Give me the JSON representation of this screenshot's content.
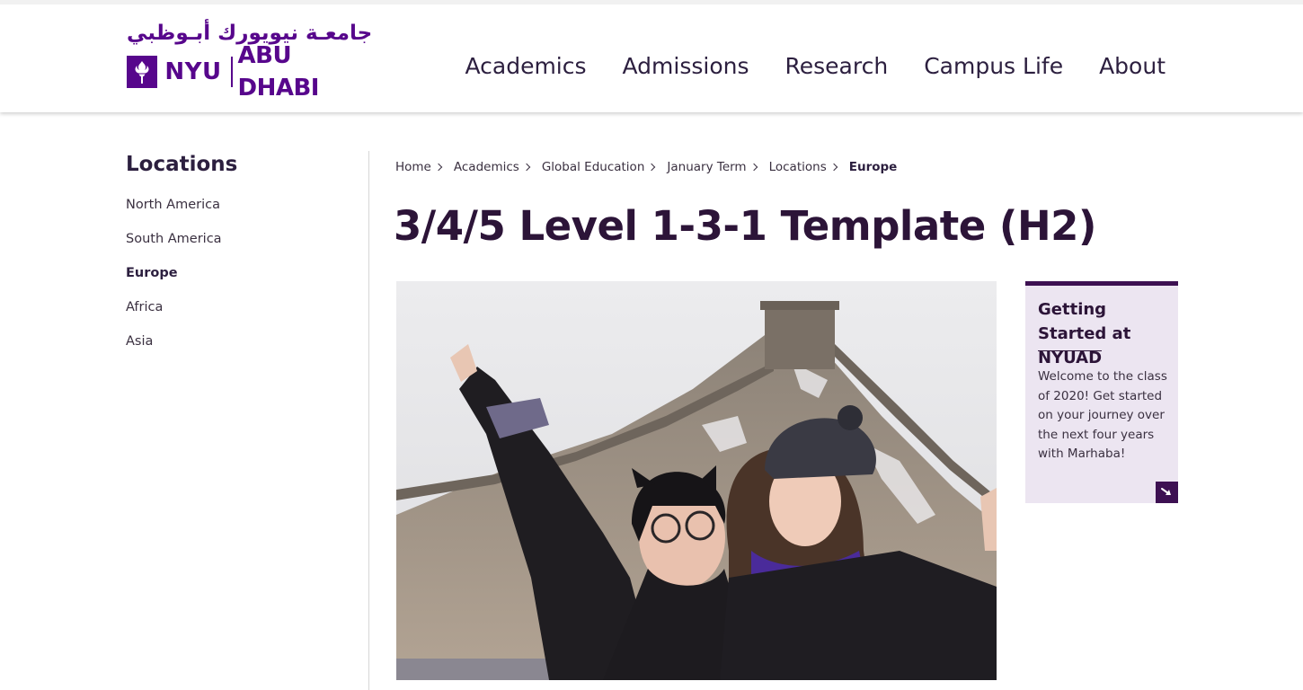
{
  "header": {
    "logo": {
      "arabic": "جامعـة نيويورك أبـوظبي",
      "nyu": "NYU",
      "abu_dhabi": "ABU DHABI"
    },
    "nav": [
      {
        "label": "Academics"
      },
      {
        "label": "Admissions"
      },
      {
        "label": "Research"
      },
      {
        "label": "Campus Life"
      },
      {
        "label": "About"
      }
    ]
  },
  "sidebar": {
    "title": "Locations",
    "items": [
      {
        "label": "North America",
        "active": false
      },
      {
        "label": "South America",
        "active": false
      },
      {
        "label": "Europe",
        "active": true
      },
      {
        "label": "Africa",
        "active": false
      },
      {
        "label": "Asia",
        "active": false
      }
    ]
  },
  "breadcrumb": [
    {
      "label": "Home"
    },
    {
      "label": "Academics"
    },
    {
      "label": "Global Education"
    },
    {
      "label": "January Term"
    },
    {
      "label": "Locations"
    },
    {
      "label": "Europe",
      "current": true
    }
  ],
  "page": {
    "title": "3/4/5 Level 1-3-1 Template (H2)"
  },
  "card": {
    "title": "Getting Started at NYUAD",
    "text": "Welcome to the class of 2020! Get started on your journey over the next four years with Marhaba!",
    "arrow_icon": "arrow-down-right-icon"
  },
  "colors": {
    "brand_purple": "#57068c",
    "dark_purple": "#3d1052",
    "card_bg": "#ece5f1",
    "heading": "#2c1438"
  }
}
